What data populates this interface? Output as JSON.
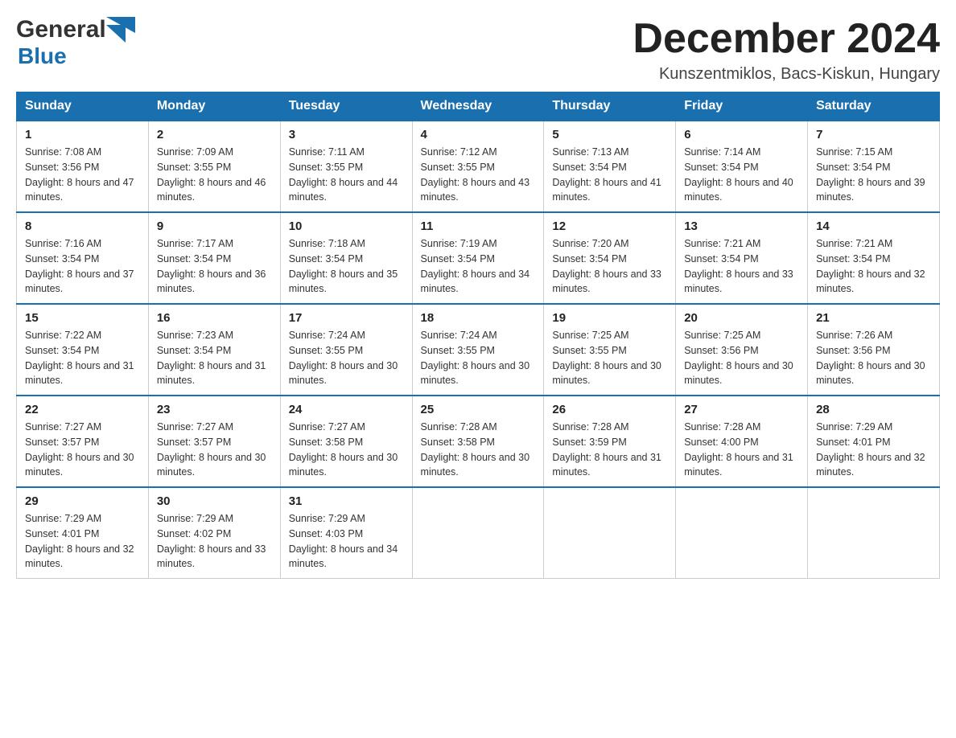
{
  "header": {
    "logo_general": "General",
    "logo_blue": "Blue",
    "month_title": "December 2024",
    "location": "Kunszentmiklos, Bacs-Kiskun, Hungary"
  },
  "days_of_week": [
    "Sunday",
    "Monday",
    "Tuesday",
    "Wednesday",
    "Thursday",
    "Friday",
    "Saturday"
  ],
  "weeks": [
    [
      {
        "day": "1",
        "sunrise": "7:08 AM",
        "sunset": "3:56 PM",
        "daylight": "8 hours and 47 minutes."
      },
      {
        "day": "2",
        "sunrise": "7:09 AM",
        "sunset": "3:55 PM",
        "daylight": "8 hours and 46 minutes."
      },
      {
        "day": "3",
        "sunrise": "7:11 AM",
        "sunset": "3:55 PM",
        "daylight": "8 hours and 44 minutes."
      },
      {
        "day": "4",
        "sunrise": "7:12 AM",
        "sunset": "3:55 PM",
        "daylight": "8 hours and 43 minutes."
      },
      {
        "day": "5",
        "sunrise": "7:13 AM",
        "sunset": "3:54 PM",
        "daylight": "8 hours and 41 minutes."
      },
      {
        "day": "6",
        "sunrise": "7:14 AM",
        "sunset": "3:54 PM",
        "daylight": "8 hours and 40 minutes."
      },
      {
        "day": "7",
        "sunrise": "7:15 AM",
        "sunset": "3:54 PM",
        "daylight": "8 hours and 39 minutes."
      }
    ],
    [
      {
        "day": "8",
        "sunrise": "7:16 AM",
        "sunset": "3:54 PM",
        "daylight": "8 hours and 37 minutes."
      },
      {
        "day": "9",
        "sunrise": "7:17 AM",
        "sunset": "3:54 PM",
        "daylight": "8 hours and 36 minutes."
      },
      {
        "day": "10",
        "sunrise": "7:18 AM",
        "sunset": "3:54 PM",
        "daylight": "8 hours and 35 minutes."
      },
      {
        "day": "11",
        "sunrise": "7:19 AM",
        "sunset": "3:54 PM",
        "daylight": "8 hours and 34 minutes."
      },
      {
        "day": "12",
        "sunrise": "7:20 AM",
        "sunset": "3:54 PM",
        "daylight": "8 hours and 33 minutes."
      },
      {
        "day": "13",
        "sunrise": "7:21 AM",
        "sunset": "3:54 PM",
        "daylight": "8 hours and 33 minutes."
      },
      {
        "day": "14",
        "sunrise": "7:21 AM",
        "sunset": "3:54 PM",
        "daylight": "8 hours and 32 minutes."
      }
    ],
    [
      {
        "day": "15",
        "sunrise": "7:22 AM",
        "sunset": "3:54 PM",
        "daylight": "8 hours and 31 minutes."
      },
      {
        "day": "16",
        "sunrise": "7:23 AM",
        "sunset": "3:54 PM",
        "daylight": "8 hours and 31 minutes."
      },
      {
        "day": "17",
        "sunrise": "7:24 AM",
        "sunset": "3:55 PM",
        "daylight": "8 hours and 30 minutes."
      },
      {
        "day": "18",
        "sunrise": "7:24 AM",
        "sunset": "3:55 PM",
        "daylight": "8 hours and 30 minutes."
      },
      {
        "day": "19",
        "sunrise": "7:25 AM",
        "sunset": "3:55 PM",
        "daylight": "8 hours and 30 minutes."
      },
      {
        "day": "20",
        "sunrise": "7:25 AM",
        "sunset": "3:56 PM",
        "daylight": "8 hours and 30 minutes."
      },
      {
        "day": "21",
        "sunrise": "7:26 AM",
        "sunset": "3:56 PM",
        "daylight": "8 hours and 30 minutes."
      }
    ],
    [
      {
        "day": "22",
        "sunrise": "7:27 AM",
        "sunset": "3:57 PM",
        "daylight": "8 hours and 30 minutes."
      },
      {
        "day": "23",
        "sunrise": "7:27 AM",
        "sunset": "3:57 PM",
        "daylight": "8 hours and 30 minutes."
      },
      {
        "day": "24",
        "sunrise": "7:27 AM",
        "sunset": "3:58 PM",
        "daylight": "8 hours and 30 minutes."
      },
      {
        "day": "25",
        "sunrise": "7:28 AM",
        "sunset": "3:58 PM",
        "daylight": "8 hours and 30 minutes."
      },
      {
        "day": "26",
        "sunrise": "7:28 AM",
        "sunset": "3:59 PM",
        "daylight": "8 hours and 31 minutes."
      },
      {
        "day": "27",
        "sunrise": "7:28 AM",
        "sunset": "4:00 PM",
        "daylight": "8 hours and 31 minutes."
      },
      {
        "day": "28",
        "sunrise": "7:29 AM",
        "sunset": "4:01 PM",
        "daylight": "8 hours and 32 minutes."
      }
    ],
    [
      {
        "day": "29",
        "sunrise": "7:29 AM",
        "sunset": "4:01 PM",
        "daylight": "8 hours and 32 minutes."
      },
      {
        "day": "30",
        "sunrise": "7:29 AM",
        "sunset": "4:02 PM",
        "daylight": "8 hours and 33 minutes."
      },
      {
        "day": "31",
        "sunrise": "7:29 AM",
        "sunset": "4:03 PM",
        "daylight": "8 hours and 34 minutes."
      },
      null,
      null,
      null,
      null
    ]
  ]
}
